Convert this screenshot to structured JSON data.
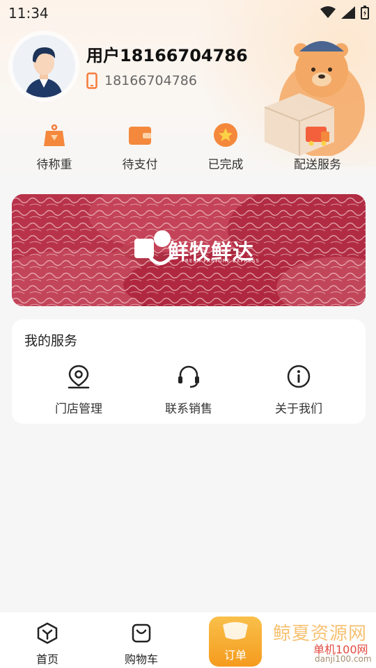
{
  "status_bar": {
    "time": "11:34"
  },
  "profile": {
    "username": "用户18166704786",
    "phone": "18166704786"
  },
  "orders": [
    {
      "label": "待称重",
      "icon": "scale-icon"
    },
    {
      "label": "待支付",
      "icon": "wallet-icon"
    },
    {
      "label": "已完成",
      "icon": "star-badge-icon"
    },
    {
      "label": "配送服务",
      "icon": "delivery-truck-icon"
    }
  ],
  "banner": {
    "brand_name": "鲜牧鲜达",
    "brand_sub": "FRESH PASTURE EXPRESS"
  },
  "services": {
    "title": "我的服务",
    "items": [
      {
        "label": "门店管理",
        "icon": "location-pin-icon"
      },
      {
        "label": "联系销售",
        "icon": "headset-icon"
      },
      {
        "label": "关于我们",
        "icon": "info-icon"
      }
    ]
  },
  "bottom_nav": {
    "items": [
      {
        "label": "首页",
        "icon": "home-hex-icon"
      },
      {
        "label": "购物车",
        "icon": "cart-bag-icon"
      },
      {
        "label": "订单",
        "icon": "order-icon"
      }
    ]
  },
  "watermark": {
    "title": "鲸夏资源网",
    "sub": "单机100网",
    "url": "danji100.com"
  },
  "colors": {
    "accent": "#f5a623",
    "icon_orange": "#f47c3c",
    "text_main": "#222222"
  }
}
